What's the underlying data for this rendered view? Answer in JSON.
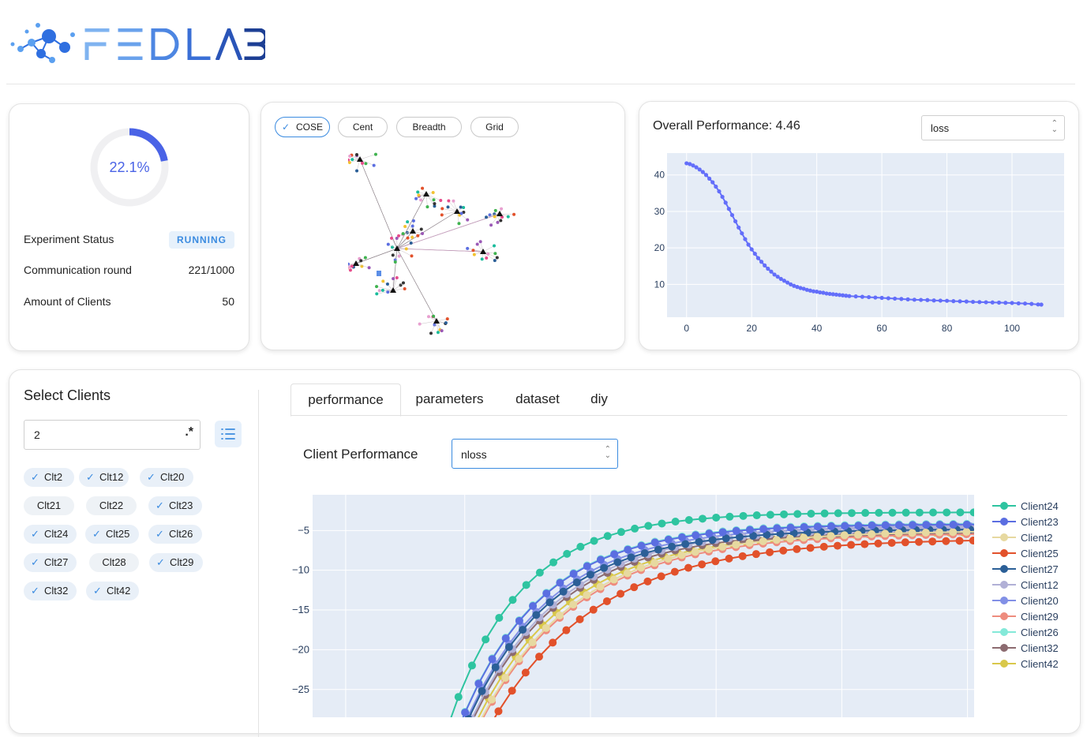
{
  "app": {
    "logo_text": "FEDLAB"
  },
  "status": {
    "progress_text": "22.1%",
    "progress_fraction": 0.221,
    "rows": [
      {
        "label": "Experiment Status",
        "value": "RUNNING"
      },
      {
        "label": "Communication round",
        "value": "221/1000"
      },
      {
        "label": "Amount of Clients",
        "value": "50"
      }
    ]
  },
  "graph": {
    "layouts": [
      "COSE",
      "Cent",
      "Breadth",
      "Grid"
    ],
    "active_layout": "COSE",
    "check_icon": "check-icon"
  },
  "overall": {
    "title": "Overall Performance: 4.46",
    "select_value": "loss",
    "chart_data": {
      "type": "line",
      "x_ticks": [
        "0",
        "20",
        "40",
        "60",
        "80",
        "100"
      ],
      "y_ticks": [
        "10",
        "20",
        "30",
        "40"
      ],
      "xlim": [
        -6,
        116
      ],
      "ylim": [
        1,
        46
      ],
      "series": [
        {
          "color": "#636efa",
          "points": [
            [
              0,
              43.2
            ],
            [
              1,
              43
            ],
            [
              2,
              42.6
            ],
            [
              3,
              42.1
            ],
            [
              4,
              41.5
            ],
            [
              5,
              40.8
            ],
            [
              6,
              40
            ],
            [
              7,
              39
            ],
            [
              8,
              38
            ],
            [
              9,
              36.8
            ],
            [
              10,
              35.5
            ],
            [
              11,
              34
            ],
            [
              12,
              32.4
            ],
            [
              13,
              30.7
            ],
            [
              14,
              29
            ],
            [
              15,
              27.3
            ],
            [
              16,
              25.6
            ],
            [
              17,
              24
            ],
            [
              18,
              22.4
            ],
            [
              19,
              20.9
            ],
            [
              20,
              19.6
            ],
            [
              21,
              18.4
            ],
            [
              22,
              17.2
            ],
            [
              23,
              16.2
            ],
            [
              24,
              15.2
            ],
            [
              25,
              14.3
            ],
            [
              26,
              13.5
            ],
            [
              27,
              12.7
            ],
            [
              28,
              12.1
            ],
            [
              29,
              11.5
            ],
            [
              30,
              11
            ],
            [
              31,
              10.5
            ],
            [
              32,
              10
            ],
            [
              33,
              9.6
            ],
            [
              34,
              9.3
            ],
            [
              35,
              9
            ],
            [
              36,
              8.8
            ],
            [
              37,
              8.5
            ],
            [
              38,
              8.3
            ],
            [
              39,
              8.1
            ],
            [
              40,
              8
            ],
            [
              41,
              7.8
            ],
            [
              42,
              7.7
            ],
            [
              43,
              7.5
            ],
            [
              44,
              7.4
            ],
            [
              45,
              7.3
            ],
            [
              46,
              7.2
            ],
            [
              47,
              7.1
            ],
            [
              48,
              7
            ],
            [
              49,
              6.9
            ],
            [
              50,
              6.8
            ],
            [
              52,
              6.7
            ],
            [
              54,
              6.6
            ],
            [
              56,
              6.5
            ],
            [
              58,
              6.4
            ],
            [
              60,
              6.3
            ],
            [
              62,
              6.2
            ],
            [
              64,
              6.1
            ],
            [
              66,
              6
            ],
            [
              68,
              5.9
            ],
            [
              70,
              5.8
            ],
            [
              72,
              5.75
            ],
            [
              74,
              5.7
            ],
            [
              76,
              5.6
            ],
            [
              78,
              5.55
            ],
            [
              80,
              5.5
            ],
            [
              82,
              5.4
            ],
            [
              84,
              5.35
            ],
            [
              86,
              5.3
            ],
            [
              88,
              5.2
            ],
            [
              90,
              5.15
            ],
            [
              92,
              5.1
            ],
            [
              94,
              5.05
            ],
            [
              96,
              5
            ],
            [
              98,
              4.95
            ],
            [
              100,
              4.9
            ],
            [
              102,
              4.8
            ],
            [
              104,
              4.75
            ],
            [
              106,
              4.65
            ],
            [
              108,
              4.5
            ],
            [
              109,
              4.46
            ]
          ]
        }
      ]
    }
  },
  "clients": {
    "title": "Select Clients",
    "search_value": "2",
    "regex_label": ".*",
    "chips": [
      {
        "label": "Clt2",
        "checked": true
      },
      {
        "label": "Clt12",
        "checked": true
      },
      {
        "label": "Clt20",
        "checked": true
      },
      {
        "label": "Clt21",
        "checked": false
      },
      {
        "label": "Clt22",
        "checked": false
      },
      {
        "label": "Clt23",
        "checked": true
      },
      {
        "label": "Clt24",
        "checked": true
      },
      {
        "label": "Clt25",
        "checked": true
      },
      {
        "label": "Clt26",
        "checked": true
      },
      {
        "label": "Clt27",
        "checked": true
      },
      {
        "label": "Clt28",
        "checked": false
      },
      {
        "label": "Clt29",
        "checked": true
      },
      {
        "label": "Clt32",
        "checked": true
      },
      {
        "label": "Clt42",
        "checked": true
      }
    ]
  },
  "tabs": [
    "performance",
    "parameters",
    "dataset",
    "diy"
  ],
  "active_tab": "performance",
  "client_perf": {
    "title": "Client Performance",
    "select_value": "nloss",
    "chart_data": {
      "type": "line",
      "y_ticks": [
        "−5",
        "−10",
        "−15",
        "−20",
        "−25"
      ],
      "ylim": [
        -28.5,
        -0.5
      ],
      "xlim": [
        0,
        100
      ],
      "series": [
        {
          "name": "Client24",
          "color": "#2ec4a0",
          "plateau": -2.7,
          "shift": 0
        },
        {
          "name": "Client23",
          "color": "#5b6ee1",
          "plateau": -4.2,
          "shift": 1
        },
        {
          "name": "Client2",
          "color": "#e7d9a0",
          "plateau": -5.0,
          "shift": 3
        },
        {
          "name": "Client25",
          "color": "#e2512b",
          "plateau": -6.0,
          "shift": 4
        },
        {
          "name": "Client27",
          "color": "#2b5f97",
          "plateau": -4.8,
          "shift": 1.5
        },
        {
          "name": "Client12",
          "color": "#b1b0d6",
          "plateau": -4.6,
          "shift": 2
        },
        {
          "name": "Client20",
          "color": "#8290e6",
          "plateau": -4.4,
          "shift": 1.5
        },
        {
          "name": "Client29",
          "color": "#ee8c7e",
          "plateau": -5.3,
          "shift": 3
        },
        {
          "name": "Client26",
          "color": "#84e9d9",
          "plateau": -4.1,
          "shift": 1
        },
        {
          "name": "Client32",
          "color": "#8c6b70",
          "plateau": -5.0,
          "shift": 2
        },
        {
          "name": "Client42",
          "color": "#d9c84a",
          "plateau": -5.1,
          "shift": 2.5
        }
      ]
    }
  }
}
